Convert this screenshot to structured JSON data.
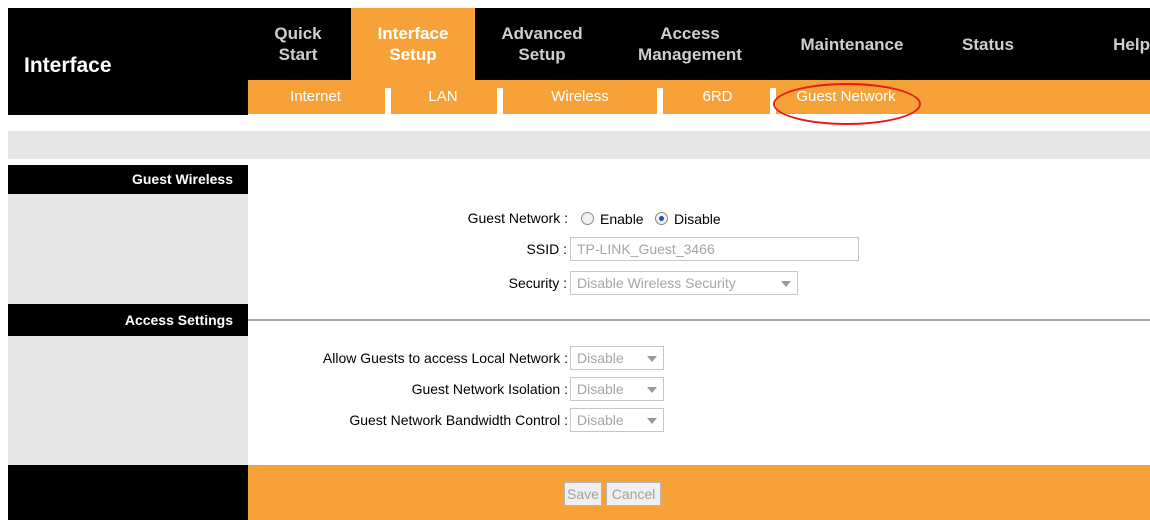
{
  "brand": {
    "title": "Interface"
  },
  "top_menu": [
    {
      "label": "Quick\nStart",
      "active": false
    },
    {
      "label": "Interface\nSetup",
      "active": true
    },
    {
      "label": "Advanced\nSetup",
      "active": false
    },
    {
      "label": "Access\nManagement",
      "active": false
    },
    {
      "label": "Maintenance",
      "active": false
    },
    {
      "label": "Status",
      "active": false
    },
    {
      "label": "Help",
      "active": false
    }
  ],
  "sub_menu": [
    {
      "label": "Internet"
    },
    {
      "label": "LAN"
    },
    {
      "label": "Wireless"
    },
    {
      "label": "6RD"
    },
    {
      "label": "Guest Network",
      "highlighted": true
    }
  ],
  "sections": {
    "guest_wireless": "Guest Wireless",
    "access_settings": "Access Settings"
  },
  "guest_wireless": {
    "guest_network_label": "Guest Network :",
    "enable_label": "Enable",
    "disable_label": "Disable",
    "selected": "Disable",
    "ssid_label": "SSID :",
    "ssid_value": "TP-LINK_Guest_3466",
    "security_label": "Security :",
    "security_value": "Disable Wireless Security"
  },
  "access_settings": {
    "local_network_label": "Allow Guests to access Local Network :",
    "local_network_value": "Disable",
    "isolation_label": "Guest Network Isolation :",
    "isolation_value": "Disable",
    "bandwidth_label": "Guest Network Bandwidth Control :",
    "bandwidth_value": "Disable"
  },
  "buttons": {
    "save": "Save",
    "cancel": "Cancel"
  },
  "colors": {
    "accent_orange": "#f6a238",
    "black": "#000000",
    "highlight_red": "#e31b1b",
    "radio_selected": "#1f4fb8"
  }
}
